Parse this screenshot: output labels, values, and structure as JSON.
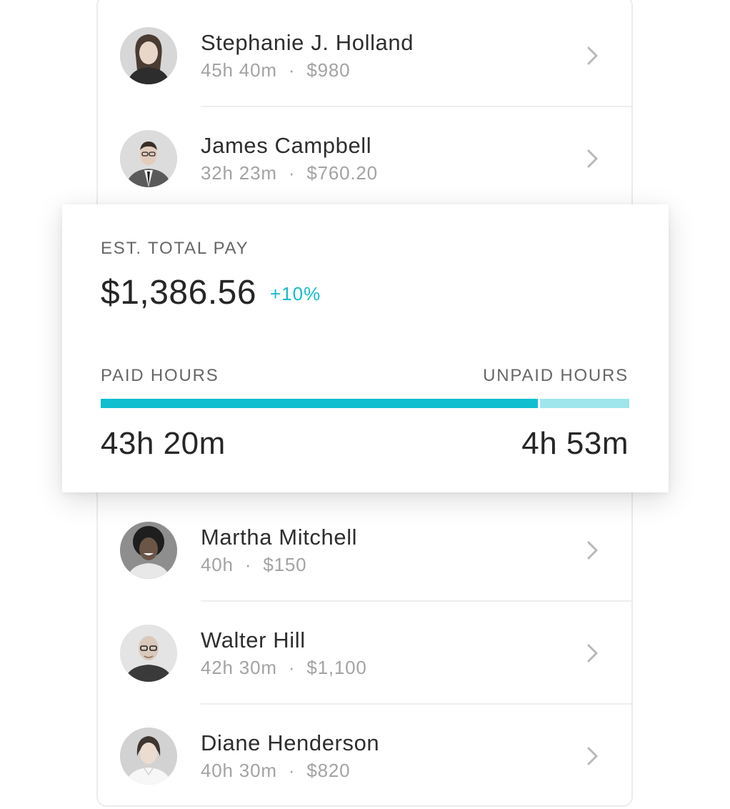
{
  "employees": [
    {
      "name": "Stephanie J. Holland",
      "hours": "45h 40m",
      "pay": "$980",
      "avatar_icon": "woman-portrait"
    },
    {
      "name": "James Campbell",
      "hours": "32h 23m",
      "pay": "$760.20",
      "avatar_icon": "man-suit-portrait"
    },
    {
      "name": "Martha Mitchell",
      "hours": "40h",
      "pay": "$150",
      "avatar_icon": "woman-curly-hair-portrait"
    },
    {
      "name": "Walter Hill",
      "hours": "42h 30m",
      "pay": "$1,100",
      "avatar_icon": "bald-man-glasses-portrait"
    },
    {
      "name": "Diane Henderson",
      "hours": "40h 30m",
      "pay": "$820",
      "avatar_icon": "woman-white-shirt-portrait"
    }
  ],
  "row_icon": "chevron-right-icon",
  "pay_summary": {
    "label": "EST. TOTAL PAY",
    "total": "$1,386.56",
    "change": "+10%",
    "paid_label": "PAID HOURS",
    "unpaid_label": "UNPAID HOURS",
    "paid_value": "43h 20m",
    "unpaid_value": "4h 53m",
    "paid_fraction": 0.83
  },
  "colors": {
    "accent": "#12bccb",
    "paid_bar": "#0fbfcf",
    "unpaid_bar": "#9ee6ec"
  }
}
